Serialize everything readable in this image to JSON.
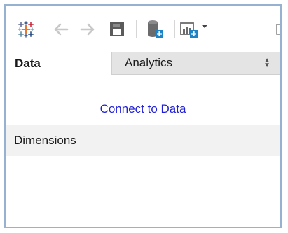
{
  "toolbar": {
    "buttons": [
      {
        "icon": "tableau-logo-icon"
      },
      {
        "icon": "back-arrow-icon"
      },
      {
        "icon": "forward-arrow-icon"
      },
      {
        "icon": "save-icon"
      },
      {
        "icon": "new-data-source-icon"
      },
      {
        "icon": "new-worksheet-icon"
      }
    ]
  },
  "tabs": {
    "data_label": "Data",
    "analytics_label": "Analytics"
  },
  "connect": {
    "link_label": "Connect to Data"
  },
  "dimensions": {
    "header_label": "Dimensions"
  },
  "colors": {
    "link": "#1f1fd8",
    "frame_border": "#97b2d0",
    "tab_inactive_bg": "#e4e4e4",
    "section_header_bg": "#f2f2f2"
  }
}
